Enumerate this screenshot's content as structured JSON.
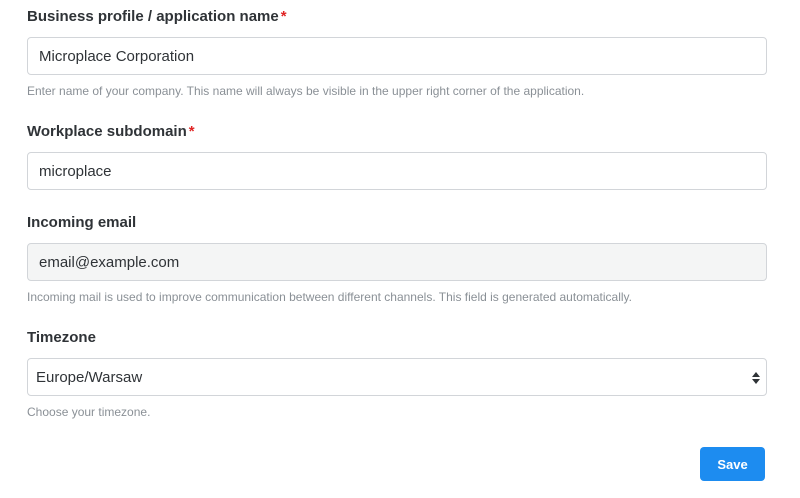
{
  "fields": {
    "business_name": {
      "label": "Business profile / application name",
      "required_mark": "*",
      "value": "Microplace Corporation",
      "help": "Enter name of your company. This name will always be visible in the upper right corner of the application."
    },
    "subdomain": {
      "label": "Workplace subdomain",
      "required_mark": "*",
      "value": "microplace"
    },
    "incoming_email": {
      "label": "Incoming email",
      "value": "email@example.com",
      "help": "Incoming mail is used to improve communication between different channels. This field is generated automatically."
    },
    "timezone": {
      "label": "Timezone",
      "value": "Europe/Warsaw",
      "help": "Choose your timezone.",
      "icon": "select-arrows-icon"
    }
  },
  "actions": {
    "save_label": "Save"
  },
  "colors": {
    "required": "#e02424",
    "primary": "#1d8cf0",
    "readonly_bg": "#f4f5f5",
    "border": "#d2d5d9",
    "help_text": "#8a9096"
  }
}
